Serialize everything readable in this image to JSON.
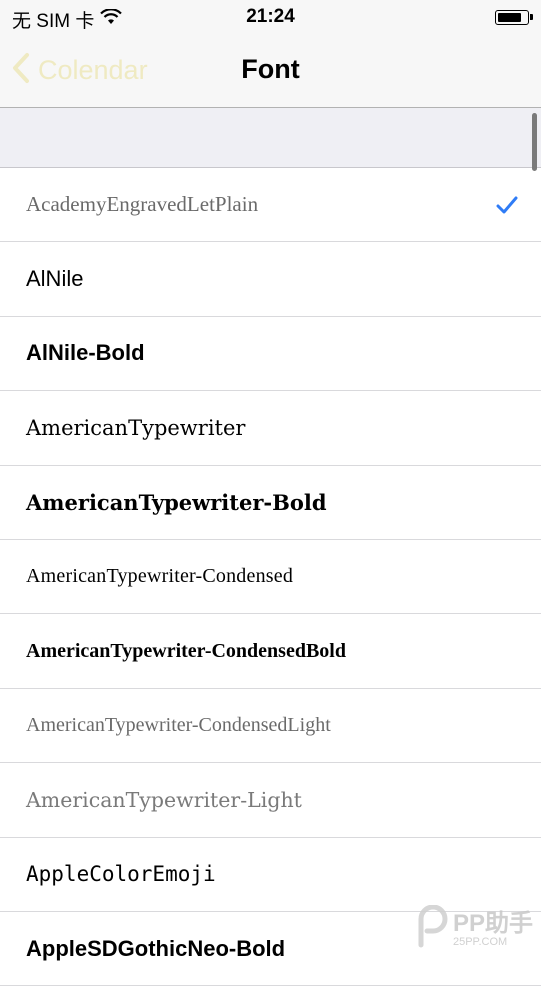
{
  "status_bar": {
    "carrier": "无 SIM 卡",
    "time": "21:24",
    "battery_level": 0.85
  },
  "nav": {
    "back_label": "Colendar",
    "title": "Font"
  },
  "fonts": [
    {
      "label": "AcademyEngravedLetPlain",
      "selected": true
    },
    {
      "label": "AlNile",
      "selected": false
    },
    {
      "label": "AlNile-Bold",
      "selected": false
    },
    {
      "label": "AmericanTypewriter",
      "selected": false
    },
    {
      "label": "AmericanTypewriter-Bold",
      "selected": false
    },
    {
      "label": "AmericanTypewriter-Condensed",
      "selected": false
    },
    {
      "label": "AmericanTypewriter-CondensedBold",
      "selected": false
    },
    {
      "label": "AmericanTypewriter-CondensedLight",
      "selected": false
    },
    {
      "label": "AmericanTypewriter-Light",
      "selected": false
    },
    {
      "label": "AppleColorEmoji",
      "selected": false
    },
    {
      "label": "AppleSDGothicNeo-Bold",
      "selected": false
    }
  ],
  "colors": {
    "accent": "#2f7cf6",
    "back_tint": "#efeac2"
  },
  "icons": {
    "back": "chevron-left-icon",
    "check": "checkmark-icon",
    "wifi": "wifi-icon",
    "battery": "battery-icon"
  },
  "watermark": {
    "brand": "PP助手",
    "domain": "25PP.COM"
  }
}
